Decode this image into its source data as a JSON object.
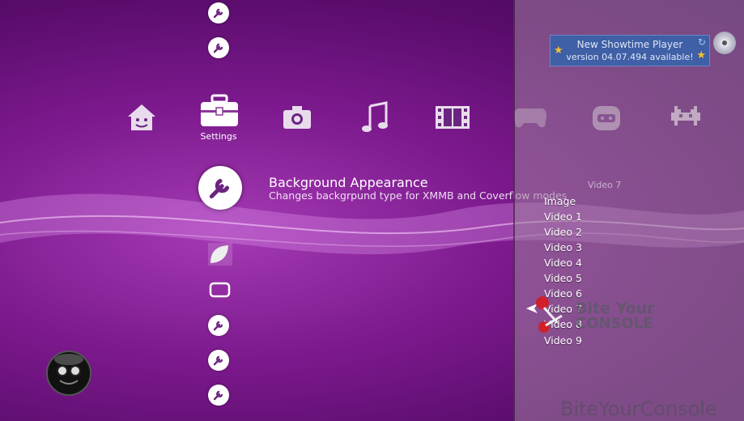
{
  "categories": [
    {
      "name": "users-icon",
      "label": ""
    },
    {
      "name": "settings-toolbox-icon",
      "label": "Settings"
    },
    {
      "name": "camera-icon",
      "label": ""
    },
    {
      "name": "music-note-icon",
      "label": ""
    },
    {
      "name": "film-strip-icon",
      "label": ""
    },
    {
      "name": "gamepad-icon",
      "label": ""
    },
    {
      "name": "network-icon",
      "label": ""
    },
    {
      "name": "space-invader-icon",
      "label": ""
    }
  ],
  "selected_category_label": "Settings",
  "selected_item": {
    "title": "Background Appearance",
    "description": "Changes backgrpund type for XMMB and Coverflow modes"
  },
  "options_panel": {
    "current_value": "Video 7",
    "options": [
      "Image",
      "Video 1",
      "Video 2",
      "Video 3",
      "Video 4",
      "Video 5",
      "Video 6",
      "Video 7",
      "Video 8",
      "Video 9"
    ]
  },
  "notification": {
    "line1": "New Showtime Player",
    "line2": "version 04.07.494 available!"
  },
  "watermark": {
    "logo_line1": "Bite Your",
    "logo_line2": "CONSOLE",
    "bottom_text": "BiteYourConsole"
  }
}
